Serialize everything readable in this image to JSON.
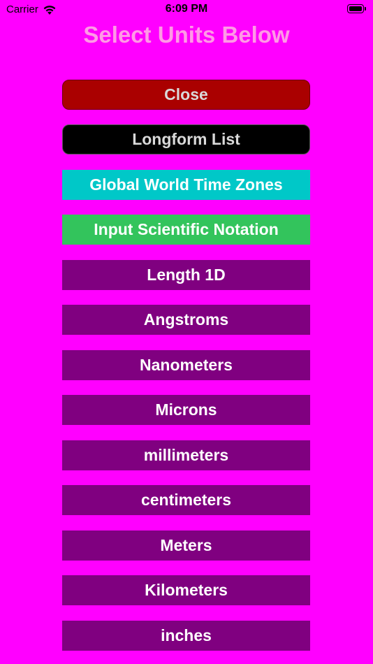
{
  "status_bar": {
    "carrier": "Carrier",
    "time": "6:09 PM",
    "wifi_icon": "wifi-icon",
    "battery_icon": "battery-icon"
  },
  "page_title": "Select Units Below",
  "buttons": {
    "close": "Close",
    "longform": "Longform List",
    "timezones": "Global World Time Zones",
    "scientific": "Input Scientific Notation"
  },
  "units": [
    "Length 1D",
    "Angstroms",
    "Nanometers",
    "Microns",
    "millimeters",
    "centimeters",
    "Meters",
    "Kilometers",
    "inches"
  ],
  "colors": {
    "background": "#ff00ff",
    "title": "#ff99e6",
    "close": "#aa0000",
    "longform": "#000000",
    "timezones": "#00c8c8",
    "scientific": "#33c45c",
    "unit_button": "#800080"
  }
}
